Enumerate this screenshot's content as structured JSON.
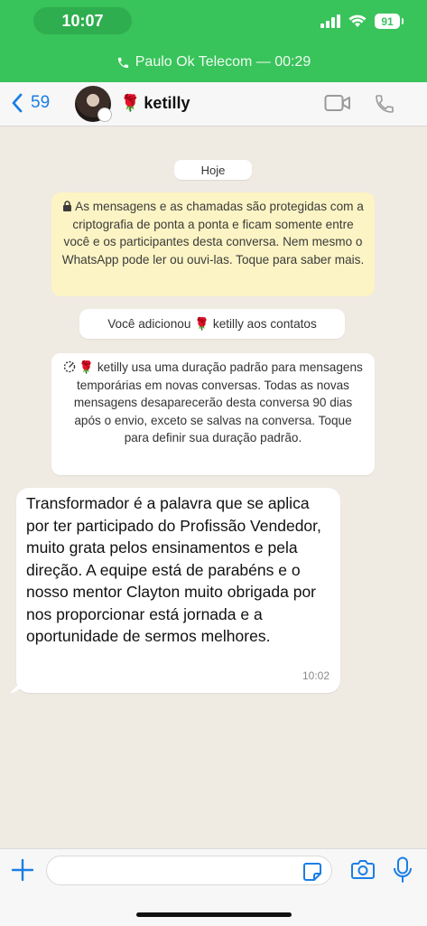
{
  "status": {
    "time": "10:07",
    "battery": "91"
  },
  "call_banner": {
    "text": "Paulo Ok Telecom — 00:29"
  },
  "header": {
    "back_count": "59",
    "contact_emoji": "🌹",
    "contact_name": "ketilly"
  },
  "chat": {
    "date": "Hoje",
    "encryption_notice": "As mensagens e as chamadas são protegidas com a criptografia de ponta a ponta e ficam somente entre você e os participantes desta conversa. Nem mesmo o WhatsApp pode ler ou ouvi-las. Toque para saber mais.",
    "contact_added": "Você adicionou 🌹 ketilly aos contatos",
    "timer_notice": "🌹 ketilly usa uma duração padrão para mensagens temporárias em novas conversas. Todas as novas mensagens desaparecerão desta conversa 90 dias após o envio, exceto se salvas na conversa. Toque para definir sua duração padrão.",
    "message": {
      "text": "Transformador é a palavra que se aplica por ter participado do Profissão Vendedor, muito grata pelos ensinamentos e pela direção. A equipe está de parabéns e o nosso mentor Clayton muito obrigada por nos proporcionar está jornada e a oportunidade de sermos melhores.",
      "time": "10:02"
    }
  },
  "composer": {
    "placeholder": ""
  },
  "colors": {
    "status_green": "#39c35b",
    "accent_blue": "#1a7ee6",
    "encryption_yellow": "#fcf4c4"
  }
}
